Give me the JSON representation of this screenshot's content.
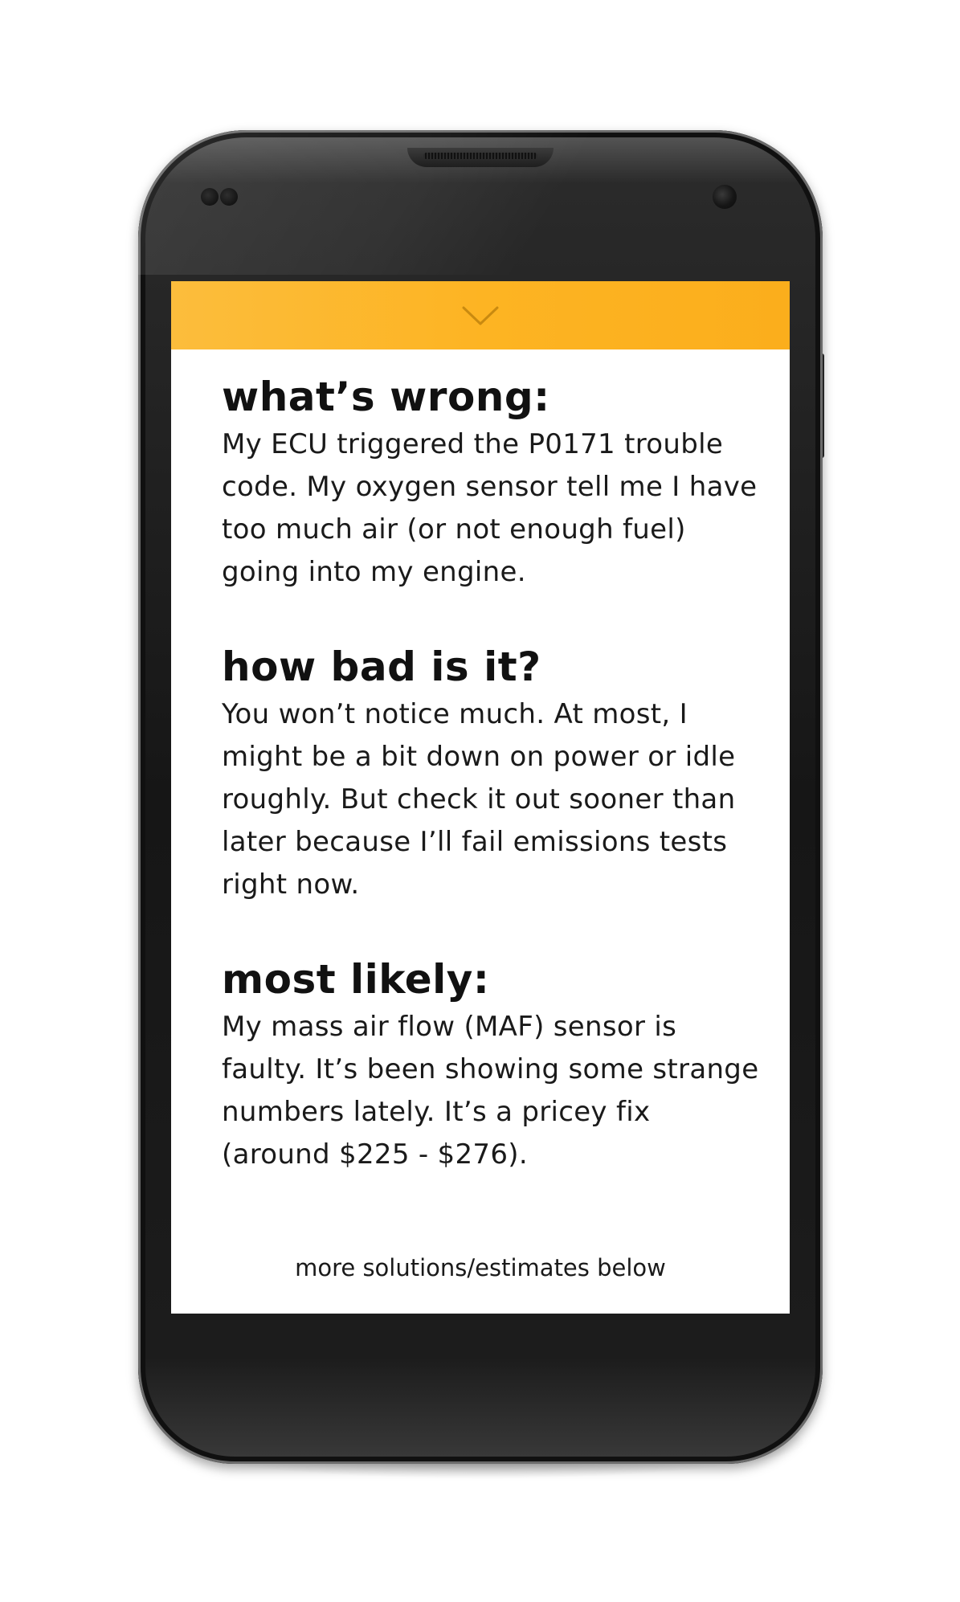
{
  "header": {
    "chevron_icon": "chevron-down-icon",
    "bar_color": "#fdb423"
  },
  "sections": [
    {
      "heading": "what’s wrong:",
      "body": "My ECU triggered the P0171 trouble code. My oxygen sensor tell me I have too much air (or not enough fuel) going into my engine."
    },
    {
      "heading": "how bad is it?",
      "body": "You won’t notice much. At most, I might be a bit down on power or idle roughly. But check it out sooner than later because I’ll fail emissions tests right now."
    },
    {
      "heading": "most likely:",
      "body": "My mass air flow (MAF) sensor is faulty. It’s been showing some strange numbers lately. It’s a pricey fix (around $225 - $276)."
    }
  ],
  "footer": {
    "more_link": "more solutions/estimates below"
  }
}
